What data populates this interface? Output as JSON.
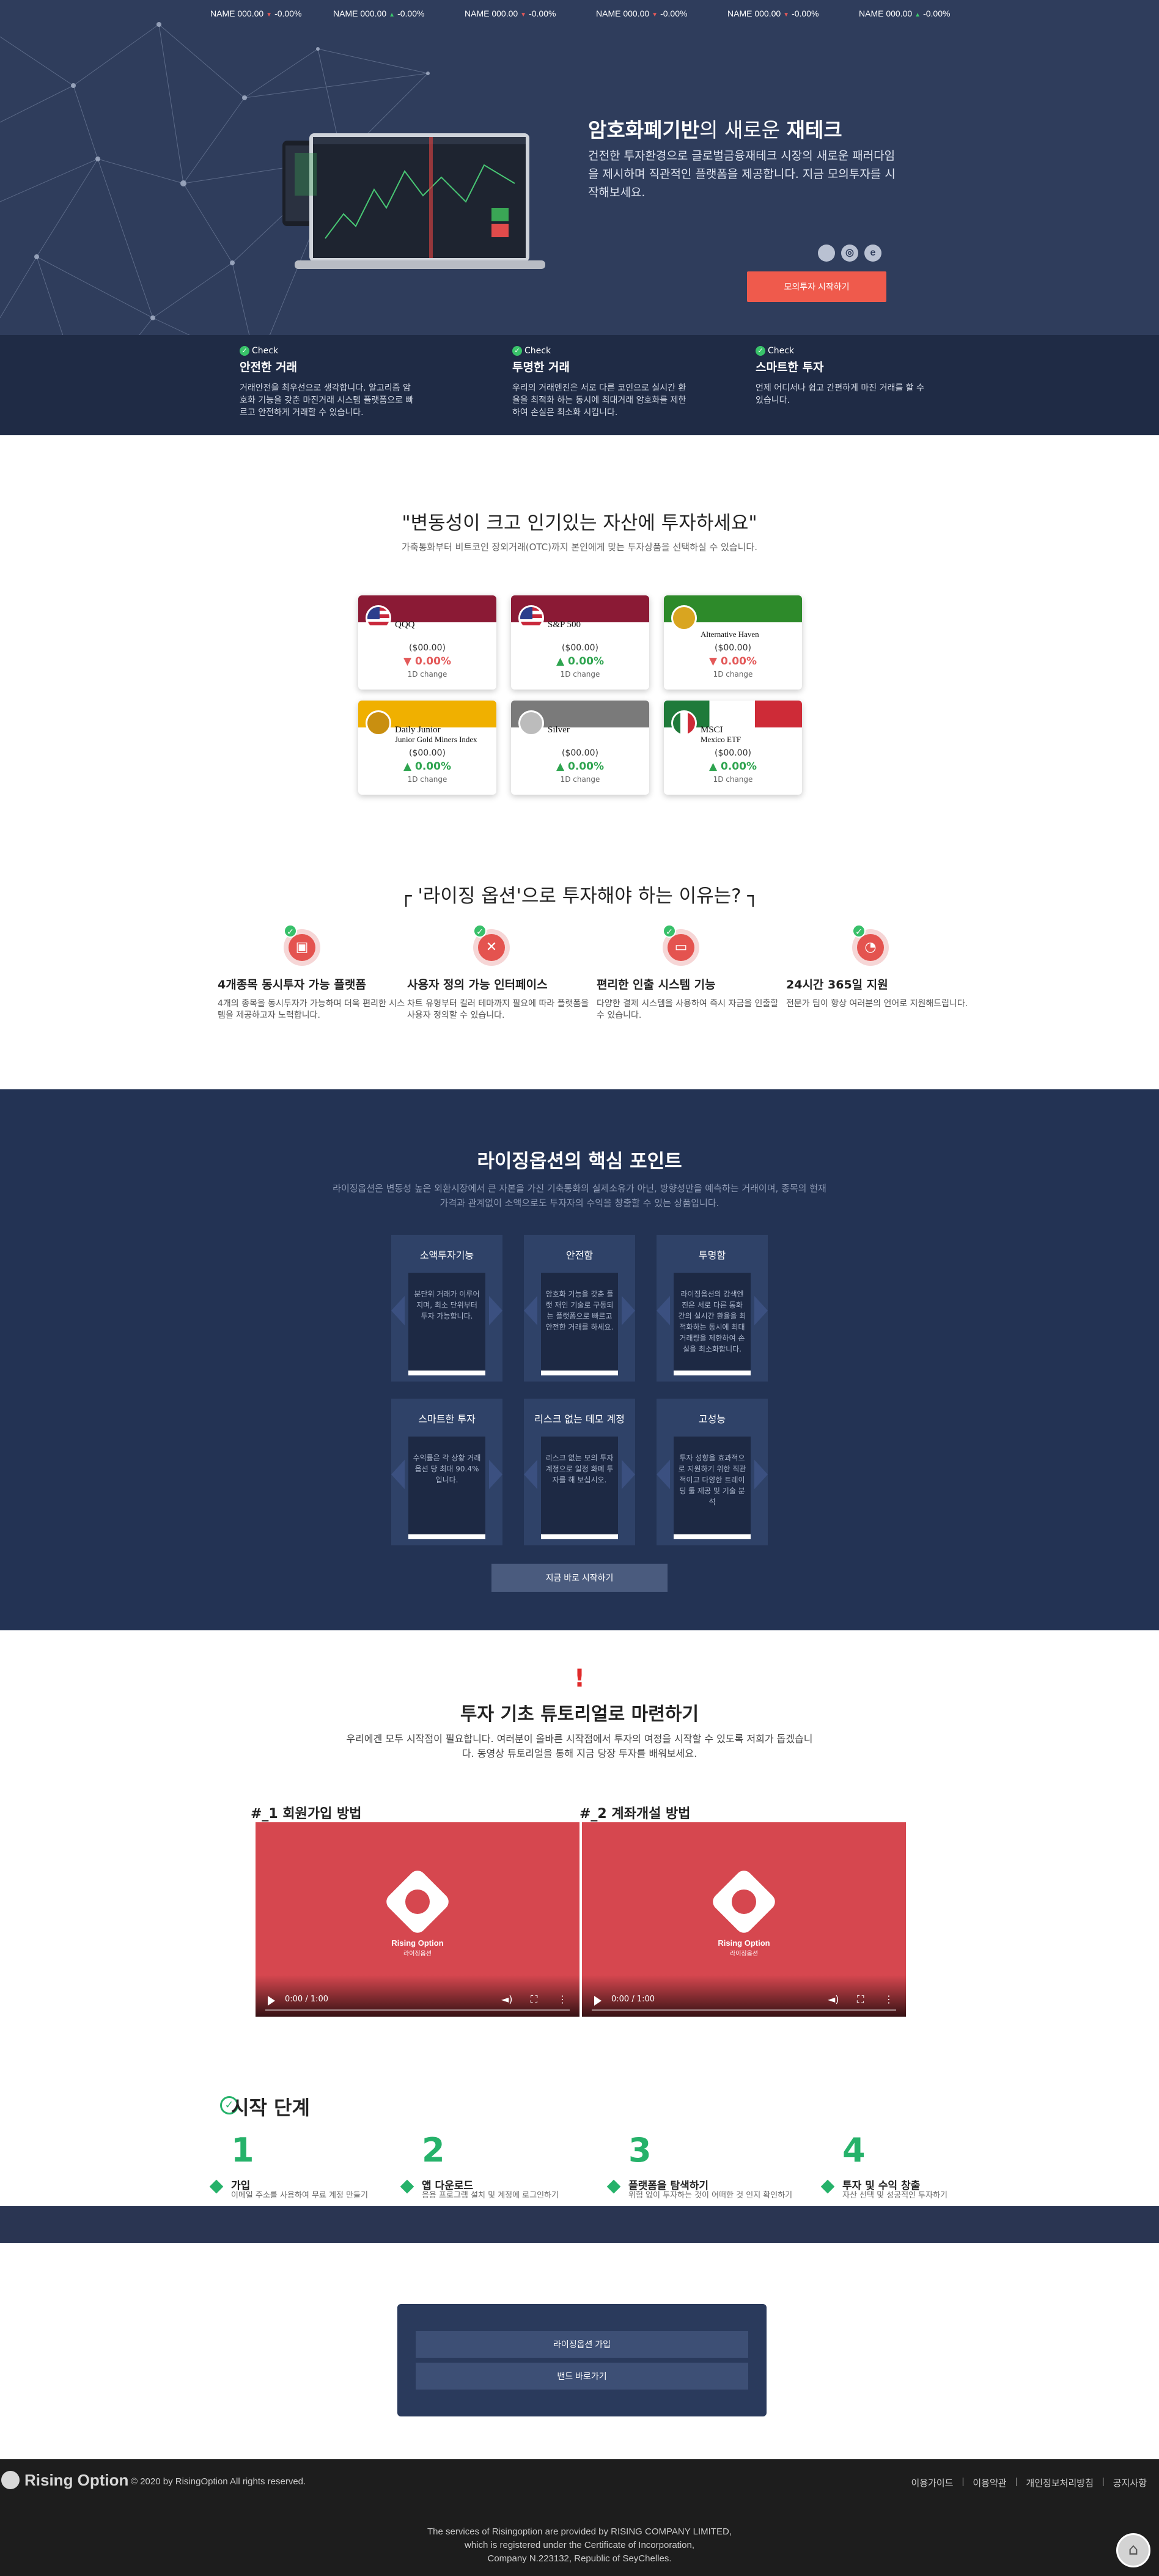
{
  "ticker": [
    {
      "name": "NAME 000.00",
      "dir": "down",
      "change": "-0.00%"
    },
    {
      "name": "NAME 000.00",
      "dir": "up",
      "change": "-0.00%"
    },
    {
      "name": "NAME 000.00",
      "dir": "down",
      "change": "-0.00%"
    },
    {
      "name": "NAME 000.00",
      "dir": "down",
      "change": "-0.00%"
    },
    {
      "name": "NAME 000.00",
      "dir": "down",
      "change": "-0.00%"
    },
    {
      "name": "NAME 000.00",
      "dir": "up",
      "change": "-0.00%"
    }
  ],
  "hero": {
    "title_bold1": "암호화폐기반",
    "title_light": "의 새로운 ",
    "title_bold2": "재테크",
    "desc": "건전한 투자환경으로 글로벌금융재테크 시장의 새로운 패러다임을 제시하며 직관적인 플랫폼을 제공합니다. 지금 모의투자를 시작해보세요.",
    "os_icons": [
      "apple-icon",
      "chrome-icon",
      "edge-icon"
    ],
    "demo_button": "모의투자 시작하기"
  },
  "checks": [
    {
      "tag": "Check",
      "title": "안전한 거래",
      "desc": "거래안전을 최우선으로 생각합니다. 알고리즘 암호화 기능을 갖춘 마진거래 시스템 플랫폼으로 빠르고 안전하게 거래할 수 있습니다."
    },
    {
      "tag": "Check",
      "title": "투명한 거래",
      "desc": "우리의 거래엔진은 서로 다른 코인으로 실시간 환율을 최적화 하는 동시에 최대거래 암호화를 제한하여 손실은 최소화 시킵니다."
    },
    {
      "tag": "Check",
      "title": "스마트한 투자",
      "desc": "언제 어디서나 쉽고 간편하게 마진 거래를 할 수 있습니다."
    }
  ],
  "assets": {
    "title": "\"변동성이 크고 인기있는 자산에 투자하세요\"",
    "subtitle": "가축통화부터 비트코인 장외거래(OTC)까지 본인에게 맞는 투자상품을 선택하실 수 있습니다.",
    "cards": [
      {
        "name": "QQQ",
        "sub": "",
        "price": "($00.00)",
        "dir": "down",
        "change": "0.00%",
        "label": "1D change",
        "color": "#8b1a35",
        "flag": "us"
      },
      {
        "name": "S&P 500",
        "sub": "",
        "price": "($00.00)",
        "dir": "up",
        "change": "0.00%",
        "label": "1D change",
        "color": "#8b1a35",
        "flag": "us"
      },
      {
        "name": "",
        "sub": "Alternative Haven",
        "price": "($00.00)",
        "dir": "down",
        "change": "0.00%",
        "label": "1D change",
        "color": "#2d8a2a",
        "flag": "coin"
      },
      {
        "name": "Daily Junior",
        "sub": "Junior Gold Miners Index",
        "price": "($00.00)",
        "dir": "up",
        "change": "0.00%",
        "label": "1D change",
        "color": "#f0b000",
        "flag": "gold"
      },
      {
        "name": "Silver",
        "sub": "",
        "price": "($00.00)",
        "dir": "up",
        "change": "0.00%",
        "label": "1D change",
        "color": "#7a7a7a",
        "flag": "silver"
      },
      {
        "name": "MSCI",
        "sub": "Mexico ETF",
        "price": "($00.00)",
        "dir": "up",
        "change": "0.00%",
        "label": "1D change",
        "color": "#1f7a3a",
        "flag": "mx"
      }
    ]
  },
  "reasons": {
    "title": "┌ '라이징 옵션'으로 투자해야 하는 이유는? ┐",
    "items": [
      {
        "icon": "chart-screen-icon",
        "glyph": "▣",
        "title": "4개종목 동시투자 가능 플랫폼",
        "desc": "4개의 종목을 동시투자가 가능하며 더욱 편리한 시스템을 제공하고자 노력합니다."
      },
      {
        "icon": "tools-icon",
        "glyph": "✕",
        "title": "사용자 정의 가능 인터페이스",
        "desc": "차트 유형부터 컬러 테마까지 필요에 따라 플랫폼을 사용자 정의할 수 있습니다."
      },
      {
        "icon": "cash-icon",
        "glyph": "▭",
        "title": "편리한 인출 시스템 기능",
        "desc": "다양한 결제 시스템을 사용하여 즉시 자금을 인출할 수 있습니다."
      },
      {
        "icon": "support-chat-icon",
        "glyph": "◔",
        "title": "24시간 365일 지원",
        "desc": "전문가 팀이 항상 여러분의 언어로 지원해드립니다."
      }
    ]
  },
  "core": {
    "title": "라이징옵션의 핵심 포인트",
    "subtitle": "라이징옵션은 변동성 높은 외환시장에서 큰 자본을 가진 기축통화의 실제소유가 아닌, 방향성만을 예측하는 거래이며, 종목의 현재 가격과 관계없이 소액으로도 투자자의 수익을 창출할 수 있는 상품입니다.",
    "points": [
      {
        "title": "소액투자기능",
        "desc": "분단위 거래가 이루어지며, 최소 단위부터 투자 가능합니다."
      },
      {
        "title": "안전함",
        "desc": "암호화 기능을 갖춘 플랫 재인 기술로 구동되는 플랫폼으로 빠르고 안전한 거래를 하세요."
      },
      {
        "title": "투명함",
        "desc": "라이징옵션의 감색엔진은 서로 다른 통화 간의 실시간 환율을 최적화하는 동시에 최대 거래량을 제한하여 손실을 최소화합니다."
      },
      {
        "title": "스마트한 투자",
        "desc": "수익률은 각 상황 거래 옵션 당 최대 90.4% 입니다."
      },
      {
        "title": "리스크 없는 데모 계정",
        "desc": "리스크 없는 모의 투자 계정으로 일정 화폐 투자를 해 보십시오."
      },
      {
        "title": "고성능",
        "desc": "투자 성향을 효과적으로 지원하기 위한 직관적이고 다양한 트레이딩 툴 제공 및 기술 분석"
      }
    ],
    "start_button": "지금 바로 시작하기"
  },
  "tutorial": {
    "bang": "!",
    "title": "투자 기초 튜토리얼로 마련하기",
    "subtitle": "우리에겐 모두 시작점이 필요합니다. 여러분이 올바른 시작점에서 투자의 여정을 시작할 수 있도록 저희가 돕겠습니다. 동영상 튜토리얼을 통해 지금 당장 투자를 배워보세요.",
    "videos": [
      {
        "label": "#_1 회원가입 방법",
        "brand": "Rising Option",
        "brand_sub": "라이징옵션",
        "time": "0:00 / 1:00"
      },
      {
        "label": "#_2 계좌개설 방법",
        "brand": "Rising Option",
        "brand_sub": "라이징옵션",
        "time": "0:00 / 1:00"
      }
    ]
  },
  "steps": {
    "title": "시작 단계",
    "items": [
      {
        "num": "1",
        "title": "가입",
        "desc": "이메일 주소를 사용하여 무료 계정 만들기"
      },
      {
        "num": "2",
        "title": "앱 다운로드",
        "desc": "응용 프로그램 설치 및 계정에 로그인하기"
      },
      {
        "num": "3",
        "title": "플랫폼을 탐색하기",
        "desc": "위험 없이 투자하는 것이 어떠한 것 인지 확인하기"
      },
      {
        "num": "4",
        "title": "투자 및 수익 창출",
        "desc": "자산 선택 및 성공적인 투자하기"
      }
    ]
  },
  "links": {
    "join": "라이징옵션 가입",
    "band": "밴드 바로가기"
  },
  "footer": {
    "brand": "Rising Option",
    "copyright": "© 2020 by RisingOption All rights reserved.",
    "links": [
      "이용가이드",
      "이용약관",
      "개인정보처리방침",
      "공지사항"
    ],
    "legal1": "The services of Risingoption are provided by RISING COMPANY LIMITED,",
    "legal2": "which is registered under the Certificate of Incorporation,",
    "legal3": "Company N.223132, Republic of SeyChelles."
  }
}
